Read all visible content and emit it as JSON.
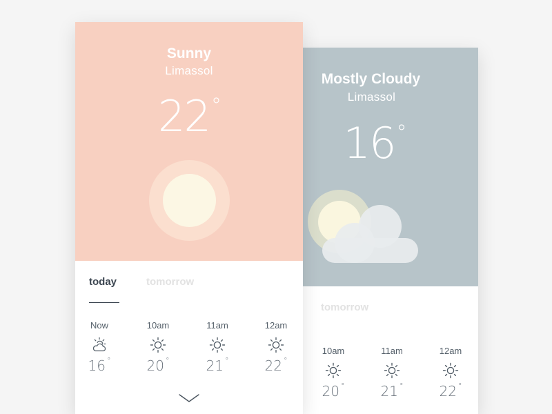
{
  "front_card": {
    "condition": "Sunny",
    "city": "Limassol",
    "temperature": "22",
    "degree_symbol": "°",
    "tabs": {
      "today": "today",
      "tomorrow": "tomorrow"
    },
    "hours": [
      {
        "time": "Now",
        "icon": "partly-cloudy-icon",
        "temp": "16",
        "deg": "°"
      },
      {
        "time": "10am",
        "icon": "sun-icon",
        "temp": "20",
        "deg": "°"
      },
      {
        "time": "11am",
        "icon": "sun-icon",
        "temp": "21",
        "deg": "°"
      },
      {
        "time": "12am",
        "icon": "sun-icon",
        "temp": "22",
        "deg": "°"
      }
    ],
    "colors": {
      "hero": "#f8d0c1",
      "sun": "#fcf7e4"
    }
  },
  "back_card": {
    "condition": "Mostly Cloudy",
    "city": "Limassol",
    "temperature": "16",
    "degree_symbol": "°",
    "tabs": {
      "tomorrow": "tomorrow"
    },
    "hours": [
      {
        "time": "10am",
        "icon": "sun-icon",
        "temp": "20",
        "deg": "°"
      },
      {
        "time": "11am",
        "icon": "sun-icon",
        "temp": "21",
        "deg": "°"
      },
      {
        "time": "12am",
        "icon": "sun-icon",
        "temp": "22",
        "deg": "°"
      }
    ],
    "colors": {
      "hero": "#b7c4c9",
      "cloud": "#e8ecee"
    }
  }
}
